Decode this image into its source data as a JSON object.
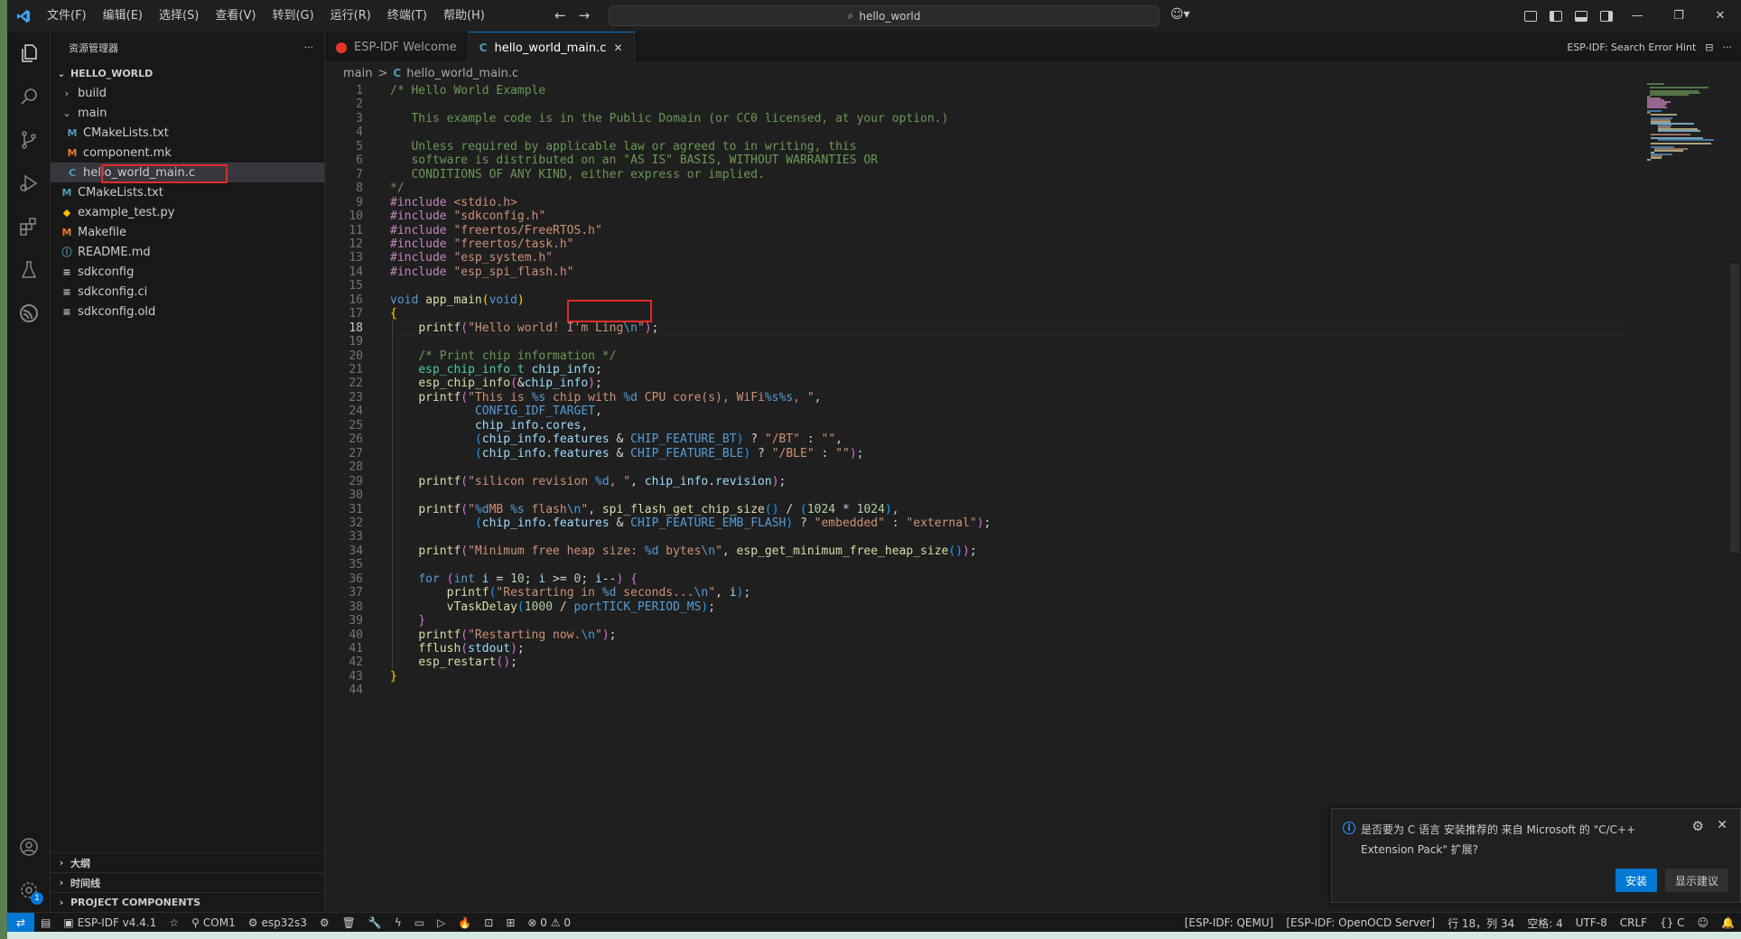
{
  "title_bar": {
    "menu": [
      "文件(F)",
      "编辑(E)",
      "选择(S)",
      "查看(V)",
      "转到(G)",
      "运行(R)",
      "终端(T)",
      "帮助(H)"
    ],
    "search_text": "hello_world",
    "copilot_icon": "copilot-icon",
    "window_controls": [
      "—",
      "❐",
      "✕"
    ]
  },
  "activity_bar": {
    "icons": [
      "explorer-icon",
      "search-icon",
      "source-control-icon",
      "run-debug-icon",
      "extensions-icon",
      "testing-icon",
      "espressif-icon"
    ],
    "bottom_icons": [
      "account-icon",
      "manage-icon"
    ],
    "manage_badge": "1"
  },
  "sidebar": {
    "title": "资源管理器",
    "more": "···",
    "root": "HELLO_WORLD",
    "items": [
      {
        "label": "build",
        "type": "folder",
        "expanded": false,
        "depth": 1,
        "icon": ""
      },
      {
        "label": "main",
        "type": "folder",
        "expanded": true,
        "depth": 1,
        "icon": ""
      },
      {
        "label": "CMakeLists.txt",
        "type": "file",
        "depth": 2,
        "icon": "M"
      },
      {
        "label": "component.mk",
        "type": "file",
        "depth": 2,
        "icon": "M"
      },
      {
        "label": "hello_world_main.c",
        "type": "file",
        "depth": 2,
        "icon": "C"
      },
      {
        "label": "CMakeLists.txt",
        "type": "file",
        "depth": 1,
        "icon": "M"
      },
      {
        "label": "example_test.py",
        "type": "file",
        "depth": 1,
        "icon": "◆"
      },
      {
        "label": "Makefile",
        "type": "file",
        "depth": 1,
        "icon": "M"
      },
      {
        "label": "README.md",
        "type": "file",
        "depth": 1,
        "icon": "ⓘ"
      },
      {
        "label": "sdkconfig",
        "type": "file",
        "depth": 1,
        "icon": "≡"
      },
      {
        "label": "sdkconfig.ci",
        "type": "file",
        "depth": 1,
        "icon": "≡"
      },
      {
        "label": "sdkconfig.old",
        "type": "file",
        "depth": 1,
        "icon": "≡"
      }
    ],
    "bottom_sections": [
      "大纲",
      "时间线",
      "PROJECT COMPONENTS"
    ]
  },
  "tabs": [
    {
      "label": "ESP-IDF Welcome",
      "active": false
    },
    {
      "label": "hello_world_main.c",
      "active": true,
      "icon": "C",
      "close": "✕"
    }
  ],
  "tab_actions": {
    "hint": "ESP-IDF: Search Error Hint",
    "more": "···"
  },
  "breadcrumb": {
    "folder": "main",
    "sep": ">",
    "icon": "C",
    "file": "hello_world_main.c"
  },
  "editor": {
    "current_line": 18,
    "lines": [
      "/* Hello World Example",
      "",
      "   This example code is in the Public Domain (or CC0 licensed, at your option.)",
      "",
      "   Unless required by applicable law or agreed to in writing, this",
      "   software is distributed on an \"AS IS\" BASIS, WITHOUT WARRANTIES OR",
      "   CONDITIONS OF ANY KIND, either express or implied.",
      "*/",
      "#include <stdio.h>",
      "#include \"sdkconfig.h\"",
      "#include \"freertos/FreeRTOS.h\"",
      "#include \"freertos/task.h\"",
      "#include \"esp_system.h\"",
      "#include \"esp_spi_flash.h\"",
      "",
      "void app_main(void)",
      "{",
      "    printf(\"Hello world! I'm Ling\\n\");",
      "",
      "    /* Print chip information */",
      "    esp_chip_info_t chip_info;",
      "    esp_chip_info(&chip_info);",
      "    printf(\"This is %s chip with %d CPU core(s), WiFi%s%s, \",",
      "            CONFIG_IDF_TARGET,",
      "            chip_info.cores,",
      "            (chip_info.features & CHIP_FEATURE_BT) ? \"/BT\" : \"\",",
      "            (chip_info.features & CHIP_FEATURE_BLE) ? \"/BLE\" : \"\");",
      "",
      "    printf(\"silicon revision %d, \", chip_info.revision);",
      "",
      "    printf(\"%dMB %s flash\\n\", spi_flash_get_chip_size() / (1024 * 1024),",
      "            (chip_info.features & CHIP_FEATURE_EMB_FLASH) ? \"embedded\" : \"external\");",
      "",
      "    printf(\"Minimum free heap size: %d bytes\\n\", esp_get_minimum_free_heap_size());",
      "",
      "    for (int i = 10; i >= 0; i--) {",
      "        printf(\"Restarting in %d seconds...\\n\", i);",
      "        vTaskDelay(1000 / portTICK_PERIOD_MS);",
      "    }",
      "    printf(\"Restarting now.\\n\");",
      "    fflush(stdout);",
      "    esp_restart();",
      "}",
      ""
    ]
  },
  "notification": {
    "text": "是否要为 C 语言 安装推荐的 来自 Microsoft 的 \"C/C++ Extension Pack\" 扩展?",
    "primary": "安装",
    "secondary": "显示建议"
  },
  "status_bar": {
    "left": [
      "ESP-IDF v4.4.1",
      "☆",
      "COM1",
      "esp32s3"
    ],
    "right": [
      "[ESP-IDF: QEMU]",
      "[ESP-IDF: OpenOCD Server]",
      "行 18，列 34",
      "空格: 4",
      "UTF-8",
      "CRLF",
      "{} C"
    ]
  },
  "colors": {
    "accent": "#0078d4",
    "highlight_box": "#e12a2a",
    "comment": "#6a9955",
    "keyword": "#569cd6",
    "string": "#ce9178"
  }
}
